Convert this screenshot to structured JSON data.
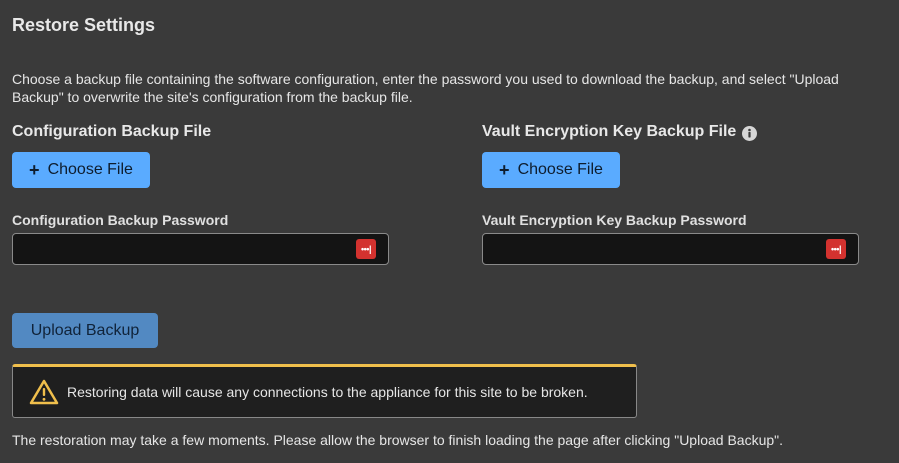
{
  "page": {
    "title": "Restore Settings",
    "description": "Choose a backup file containing the software configuration, enter the password you used to download the backup, and select \"Upload Backup\" to overwrite the site's configuration from the backup file."
  },
  "config_backup": {
    "heading": "Configuration Backup File",
    "choose_label": "Choose File",
    "password_label": "Configuration Backup Password",
    "password_value": ""
  },
  "vault_backup": {
    "heading": "Vault Encryption Key Backup File",
    "choose_label": "Choose File",
    "password_label": "Vault Encryption Key Backup Password",
    "password_value": ""
  },
  "pw_manager_icon_text": "•••|",
  "upload_label": "Upload Backup",
  "warning": {
    "text": "Restoring data will cause any connections to the appliance for this site to be broken.",
    "color": "#f0bf4c"
  },
  "footnote": "The restoration may take a few moments. Please allow the browser to finish loading the page after clicking \"Upload Backup\".",
  "colors": {
    "background": "#3a3a3a",
    "primary_button": "#5aabff",
    "upload_button": "#5289c2",
    "pw_manager": "#d3322f"
  },
  "icons": {
    "plus": "plus-icon",
    "info": "info-icon",
    "password_manager": "password-manager-icon",
    "warning": "warning-icon"
  }
}
